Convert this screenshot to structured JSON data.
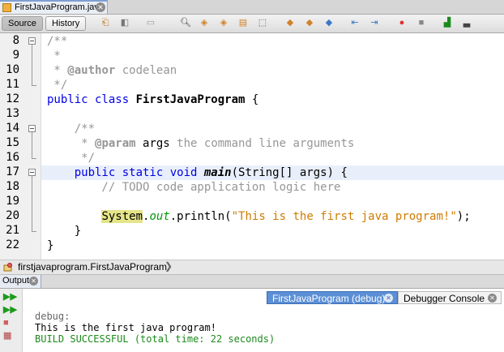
{
  "file_tab": {
    "label": "FirstJavaProgram.java"
  },
  "toolbar": {
    "source_label": "Source",
    "history_label": "History"
  },
  "gutter": {
    "line_numbers": [
      "8",
      "9",
      "10",
      "11",
      "12",
      "13",
      "14",
      "15",
      "16",
      "17",
      "18",
      "19",
      "20",
      "21",
      "22"
    ]
  },
  "code": {
    "l8": "/**",
    "l9": " *",
    "l10_a": " * ",
    "l10_tag": "@author",
    "l10_b": " codelean",
    "l11": " */",
    "l12_kw": "public class ",
    "l12_name": "FirstJavaProgram",
    "l12_b": " {",
    "l14": "    /**",
    "l15_a": "     * ",
    "l15_tag": "@param",
    "l15_arg": " args",
    "l15_b": " the command line arguments",
    "l16": "     */",
    "l17_kw": "    public static void ",
    "l17_name": "main",
    "l17_b": "(String[] args) {",
    "l18": "        // TODO code application logic here",
    "l20_pad": "        ",
    "l20_sys": "System",
    "l20_dot": ".",
    "l20_out": "out",
    "l20_call": ".println(",
    "l20_str": "\"This is the first java program!\"",
    "l20_end": ");",
    "l21": "    }",
    "l22": "}"
  },
  "breadcrumb": {
    "label": "firstjavaprogram.FirstJavaProgram"
  },
  "output": {
    "tab_label": "Output",
    "debug_tab": "FirstJavaProgram (debug)",
    "console_tab": "Debugger Console",
    "lines": [
      "debug:",
      "This is the first java program!",
      "BUILD SUCCESSFUL (total time: 22 seconds)"
    ]
  },
  "colors": {
    "keyword": "#0000e6",
    "string": "#ce7b00",
    "comment": "#969696",
    "build_success": "#1c8a1c",
    "active_tab": "#5b8fd6"
  }
}
